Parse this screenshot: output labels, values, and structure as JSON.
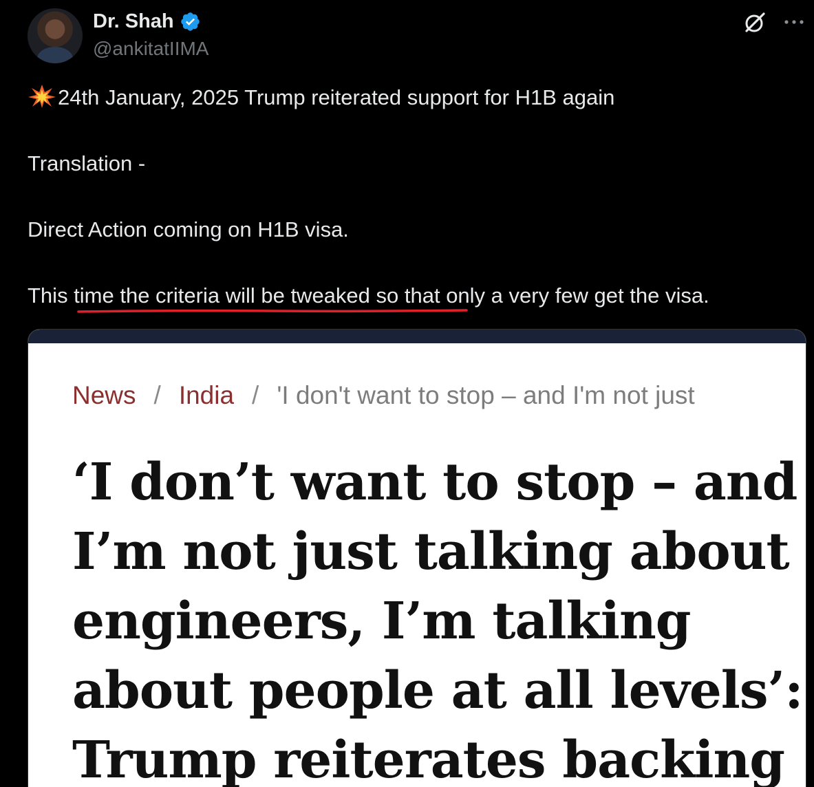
{
  "tweet": {
    "author": {
      "name": "Dr. Shah",
      "handle": "@ankitatIIMA",
      "verified_icon": "verified-badge-icon",
      "avatar_icon": "avatar"
    },
    "icons": {
      "grok": "grok-icon",
      "more": "more-options-icon"
    },
    "text": {
      "line1": "24th January, 2025 Trump reiterated support for H1B again",
      "line1_emoji": "collision-emoji",
      "line2": "Translation -",
      "line3": "Direct Action coming on H1B visa.",
      "line4": "This time the criteria will be tweaked so that only a very few get the visa."
    },
    "colors": {
      "background": "#000000",
      "text": "#e7e9ea",
      "handle": "#71767b",
      "verified": "#1d9bf0",
      "underline": "#e0202a"
    }
  },
  "article_card": {
    "breadcrumb": {
      "news": "News",
      "separator": "/",
      "india": "India",
      "current": "'I don't want to stop – and I'm not just"
    },
    "headline_lines": [
      "‘I don’t want to stop – and",
      "I’m not just talking about",
      "engineers, I’m talking",
      "about people at all levels’:",
      "Trump reiterates backing"
    ],
    "colors": {
      "topbar": "#1a2238",
      "breadcrumb_link": "#8a3030",
      "breadcrumb_muted": "#7d7d7d",
      "headline": "#111111"
    }
  }
}
